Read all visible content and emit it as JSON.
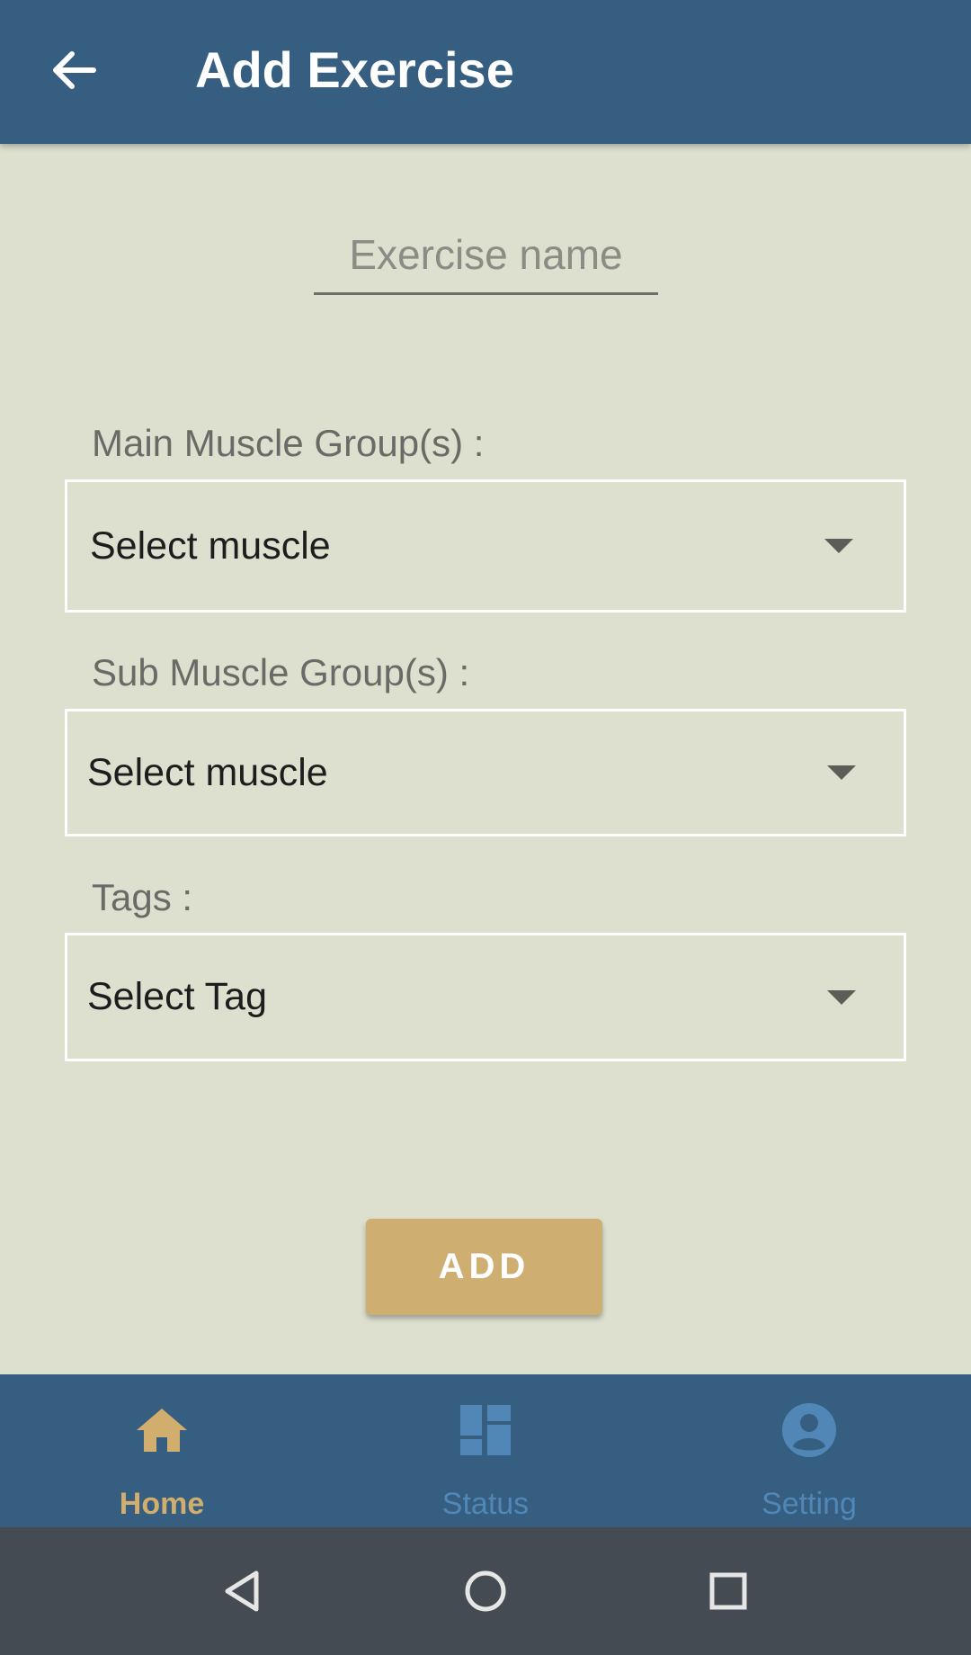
{
  "header": {
    "title": "Add Exercise",
    "back_icon": "arrow-left-icon"
  },
  "form": {
    "exercise_name": {
      "placeholder": "Exercise name",
      "value": ""
    },
    "main_muscle": {
      "label": "Main Muscle Group(s) :",
      "selected": "Select muscle"
    },
    "sub_muscle": {
      "label": "Sub Muscle Group(s) :",
      "selected": "Select muscle"
    },
    "tags": {
      "label": "Tags :",
      "selected": "Select Tag"
    },
    "add_label": "ADD"
  },
  "bottom_nav": {
    "items": [
      {
        "label": "Home",
        "icon": "home-icon",
        "active": true
      },
      {
        "label": "Status",
        "icon": "dashboard-icon",
        "active": false
      },
      {
        "label": "Setting",
        "icon": "account-icon",
        "active": false
      }
    ]
  },
  "system_nav": {
    "icons": [
      "back-triangle-icon",
      "home-circle-icon",
      "recents-square-icon"
    ]
  },
  "colors": {
    "app_bar": "#365e80",
    "background": "#dddfcf",
    "accent": "#cfae72",
    "nav_active": "#d1ad6e",
    "nav_inactive": "#5187b7",
    "system_bar": "#454b53"
  }
}
